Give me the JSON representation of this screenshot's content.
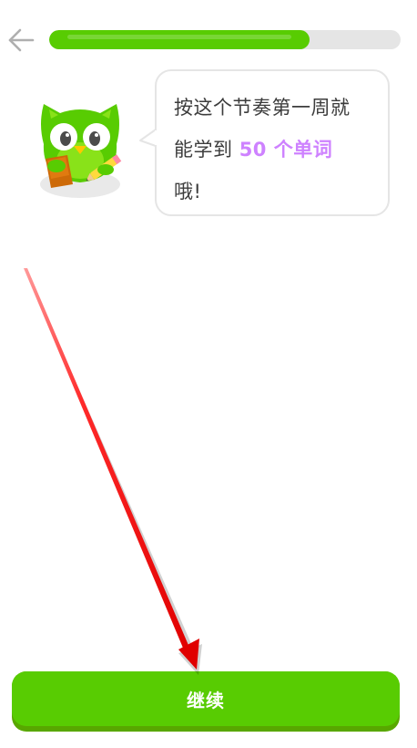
{
  "header": {
    "back_icon": "arrow-left-icon",
    "progress_fraction": 0.74
  },
  "mascot": {
    "icon": "duo-owl-mascot-icon"
  },
  "speech": {
    "line_1": "按这个节奏第一周就",
    "line_2_prefix": "能学到 ",
    "line_2_highlight": "50 个单词",
    "line_3": "哦!"
  },
  "footer": {
    "continue_label": "继续"
  },
  "colors": {
    "brand_green": "#58cc02",
    "brand_green_dark": "#58a700",
    "highlight_purple": "#ce82ff",
    "track_gray": "#e5e5e5",
    "annotation_red": "#e00000"
  }
}
